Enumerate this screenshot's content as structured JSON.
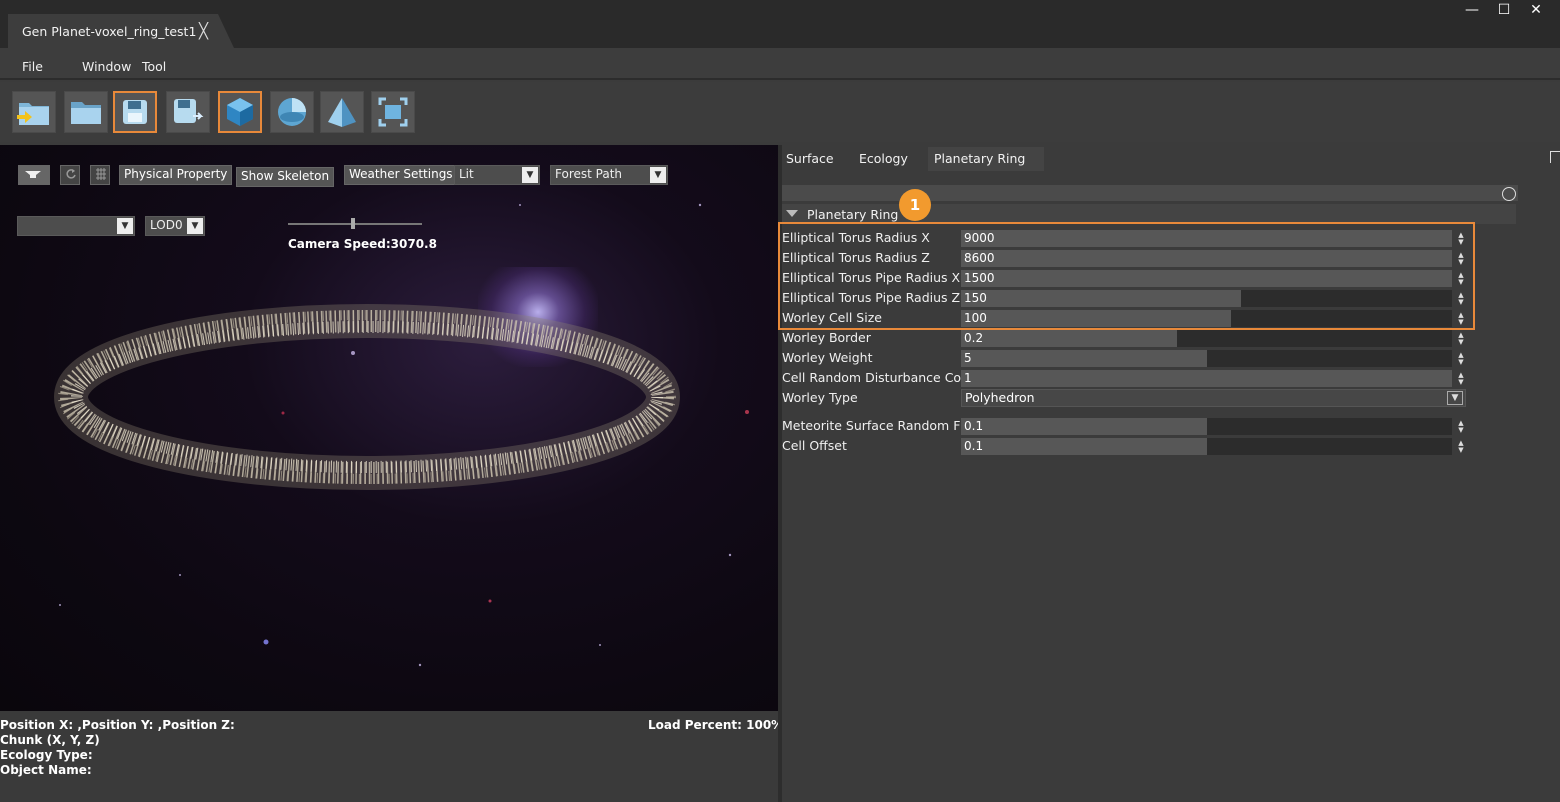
{
  "titlebar": {
    "doc_tab": "Gen Planet-voxel_ring_test1",
    "close_glyph": "╳",
    "win": {
      "minimize": "—",
      "maximize": "☐",
      "close": "✕"
    }
  },
  "menu": {
    "file": "File",
    "window": "Window",
    "tool": "Tool"
  },
  "toolbar": {
    "buttons": [
      {
        "icon": "import-folder-icon",
        "highlighted": false
      },
      {
        "icon": "open-folder-icon",
        "highlighted": false
      },
      {
        "icon": "save-icon",
        "highlighted": true
      },
      {
        "icon": "save-as-icon",
        "highlighted": false
      },
      {
        "icon": "cube-icon",
        "highlighted": true
      },
      {
        "icon": "sphere-icon",
        "highlighted": false
      },
      {
        "icon": "pyramid-icon",
        "highlighted": false
      },
      {
        "icon": "screenshot-icon",
        "highlighted": false
      }
    ],
    "highlight_color": "#e8893a"
  },
  "viewport": {
    "physical_property": "Physical Property",
    "show_skeleton": "Show Skeleton",
    "weather_settings": "Weather Settings",
    "shading_mode": "Lit",
    "path_mode": "Forest Path",
    "lod": "LOD0",
    "camera_speed": "Camera Speed:3070.8",
    "load_percent": "Load Percent: 100%",
    "status": {
      "position": "Position X: ,Position Y: ,Position Z:",
      "chunk": "Chunk (X, Y, Z)",
      "ecology": "Ecology Type:",
      "object": "Object Name:"
    }
  },
  "panel": {
    "tabs": [
      "Surface",
      "Ecology",
      "Planetary Ring"
    ],
    "section": "Planetary Ring",
    "badge": "1",
    "properties": [
      {
        "label": "Elliptical Torus Radius X",
        "value": "9000",
        "fill": 1.0
      },
      {
        "label": "Elliptical Torus Radius Z",
        "value": "8600",
        "fill": 1.0
      },
      {
        "label": "Elliptical Torus Pipe Radius  X",
        "value": "1500",
        "fill": 1.0
      },
      {
        "label": "Elliptical Torus Pipe Radius Z",
        "value": "150",
        "fill": 0.57
      },
      {
        "label": "Worley Cell Size",
        "value": "100",
        "fill": 0.55
      },
      {
        "label": "Worley Border",
        "value": "0.2",
        "fill": 0.44
      },
      {
        "label": "Worley Weight",
        "value": "5",
        "fill": 0.5
      },
      {
        "label": "Cell Random Disturbance Coefficient",
        "value": "1",
        "fill": 1.0
      },
      {
        "label": "Worley Type",
        "value": "Polyhedron",
        "type": "dropdown"
      },
      {
        "label": "Meteorite Surface Random Fluctuation",
        "value": "0.1",
        "fill": 0.5
      },
      {
        "label": "Cell Offset",
        "value": "0.1",
        "fill": 0.5
      }
    ]
  }
}
